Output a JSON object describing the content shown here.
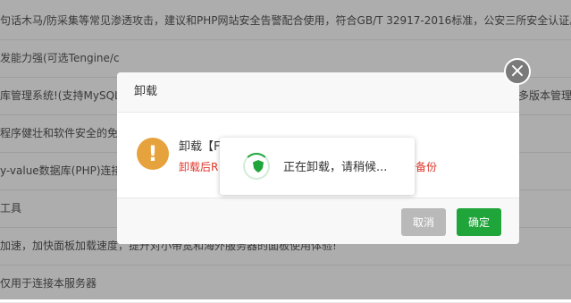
{
  "background_rows": [
    "句话木马/防采集等常见渗透攻击，建议和PHP网站安全告警配合使用，符合GB/T 32917-2016标准，公安三所安全认证。",
    "发能力强(可选Tengine/c",
    "库管理系统!(支持MySQL(",
    "程序健壮和软件安全的免费",
    "y-value数据库(PHP)连接r",
    "工具",
    "加速，加快面板加载速度，提升对小带宽和海外服务器的面板使用体验!",
    "仅用于连接本服务器"
  ],
  "background_right_fragment": "多版本管理",
  "dialog": {
    "title": "卸载",
    "body_title": "卸载【F",
    "body_warning_left": "卸载后R",
    "body_warning_right": "行备份",
    "cancel_label": "取消",
    "confirm_label": "确定",
    "close_glyph": "×"
  },
  "loading": {
    "text": "正在卸载，请稍候..."
  },
  "colors": {
    "accent": "#20a53a",
    "warning": "#e6a23c",
    "danger": "#e0362b",
    "disabled": "#b9b9b9"
  }
}
